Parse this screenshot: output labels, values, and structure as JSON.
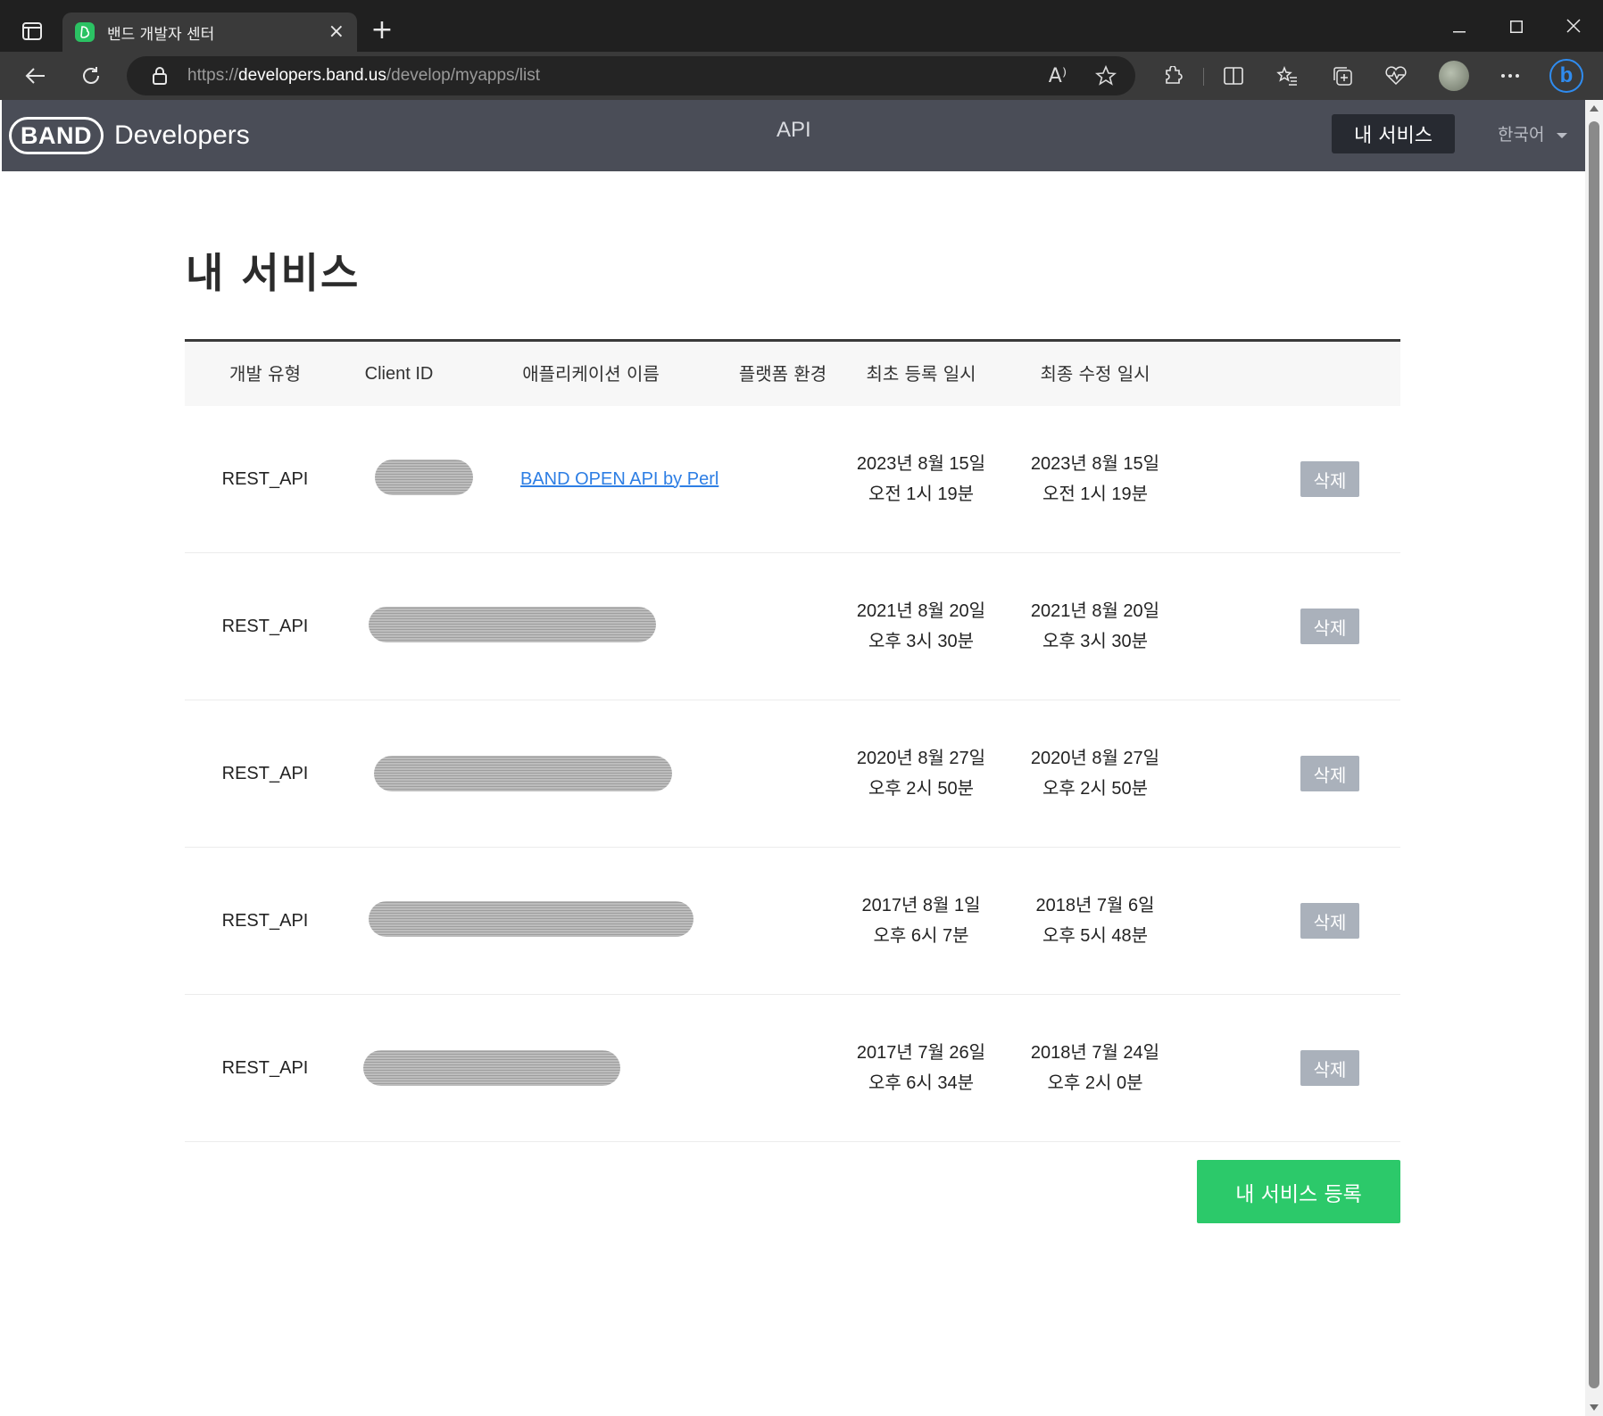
{
  "browser": {
    "tab_title": "밴드 개발자 센터",
    "url_prefix": "https://",
    "url_host": "developers.band.us",
    "url_path": "/develop/myapps/list",
    "read_aloud_label": "A⁾"
  },
  "header": {
    "logo_band": "BAND",
    "logo_developers": "Developers",
    "nav_api": "API",
    "nav_my_services": "내 서비스",
    "language": "한국어"
  },
  "page": {
    "title": "내 서비스"
  },
  "table": {
    "headers": {
      "dev_type": "개발 유형",
      "client_id": "Client ID",
      "app_name": "애플리케이션 이름",
      "platform": "플랫폼 환경",
      "created": "최초 등록 일시",
      "modified": "최종 수정 일시"
    },
    "rows": [
      {
        "dev_type": "REST_API",
        "app_name": "BAND OPEN API by Perl",
        "created_date": "2023년 8월 15일",
        "created_time": "오전 1시 19분",
        "modified_date": "2023년 8월 15일",
        "modified_time": "오전 1시 19분",
        "delete_label": "삭제"
      },
      {
        "dev_type": "REST_API",
        "app_name": "",
        "created_date": "2021년 8월 20일",
        "created_time": "오후 3시 30분",
        "modified_date": "2021년 8월 20일",
        "modified_time": "오후 3시 30분",
        "delete_label": "삭제"
      },
      {
        "dev_type": "REST_API",
        "app_name": "",
        "created_date": "2020년 8월 27일",
        "created_time": "오후 2시 50분",
        "modified_date": "2020년 8월 27일",
        "modified_time": "오후 2시 50분",
        "delete_label": "삭제"
      },
      {
        "dev_type": "REST_API",
        "app_name": "",
        "created_date": "2017년 8월 1일",
        "created_time": "오후 6시 7분",
        "modified_date": "2018년 7월 6일",
        "modified_time": "오후 5시 48분",
        "delete_label": "삭제"
      },
      {
        "dev_type": "REST_API",
        "app_name": "",
        "created_date": "2017년 7월 26일",
        "created_time": "오후 6시 34분",
        "modified_date": "2018년 7월 24일",
        "modified_time": "오후 2시 0분",
        "delete_label": "삭제"
      }
    ]
  },
  "register_button": "내 서비스 등록",
  "colors": {
    "header_bg": "#4a4d57",
    "register_green": "#2cc96a",
    "delete_gray": "#aab1bb",
    "link_blue": "#2d7ee4"
  }
}
